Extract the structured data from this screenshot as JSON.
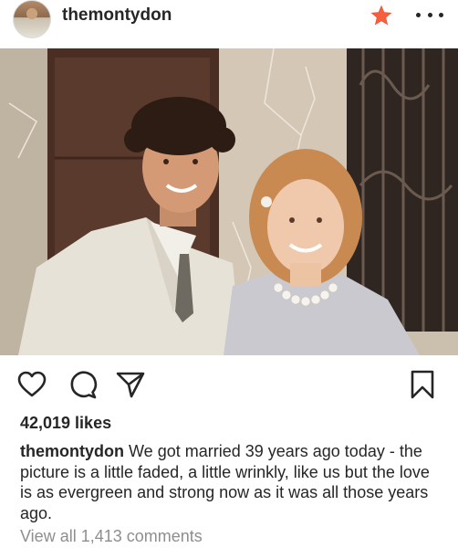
{
  "post": {
    "username": "themontydon",
    "likes_text": "42,019 likes",
    "caption_username": "themontydon",
    "caption_text": "We got married 39 years ago today - the picture is a little faded, a little wrinkly, like us but the love  is as evergreen and strong  now as it was all those years ago.",
    "view_comments_text": "View all 1,413 comments"
  },
  "icons": {
    "avatar": "avatar",
    "favorite": "star-icon",
    "more": "more-options-icon",
    "like": "heart-icon",
    "comment": "comment-icon",
    "share": "send-icon",
    "save": "bookmark-icon"
  },
  "colors": {
    "text": "#262626",
    "muted": "#8e8e8e",
    "star": "#f56040",
    "background": "#ffffff"
  }
}
